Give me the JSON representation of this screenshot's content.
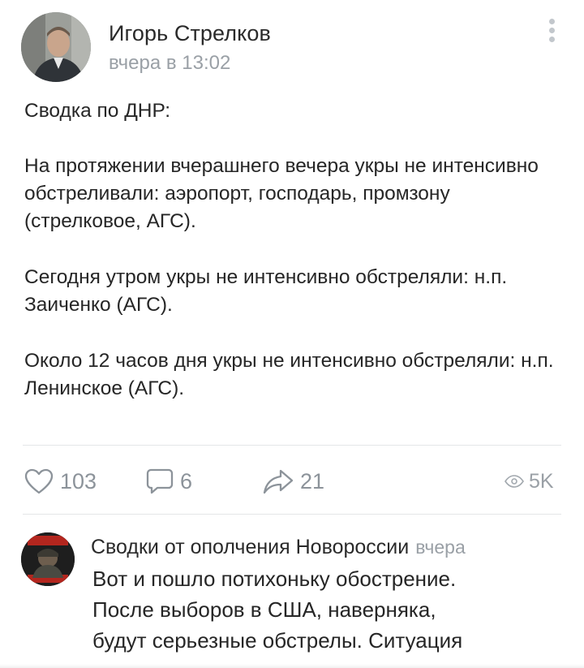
{
  "post": {
    "author": "Игорь Стрелков",
    "time": "вчера в 13:02",
    "paragraphs": [
      "Сводка по ДНР:",
      "На протяжении вчерашнего вечера укры не интенсивно обстреливали: аэропорт, господарь, промзону (стрелковое, АГС).",
      "Сегодня утром укры не интенсивно обстреляли: н.п. Заиченко (АГС).",
      "Около 12 часов дня укры не интенсивно обстреляли: н.п. Ленинское (АГС)."
    ]
  },
  "actions": {
    "likes": "103",
    "comments": "6",
    "shares": "21",
    "views": "5K"
  },
  "comment": {
    "author": "Сводки от ополчения Новороссии",
    "time": "вчера",
    "lines": [
      "Вот и пошло потихоньку обострение.",
      "После выборов в США, наверняка,",
      "будут серьезные обстрелы. Ситуация"
    ]
  },
  "icons": {
    "like": "heart-icon",
    "comment": "comment-icon",
    "share": "share-icon",
    "views": "eye-icon",
    "more": "more-vertical-icon"
  },
  "colors": {
    "icon_gray": "#8c939a",
    "secondary_text": "#9aa0a6"
  }
}
